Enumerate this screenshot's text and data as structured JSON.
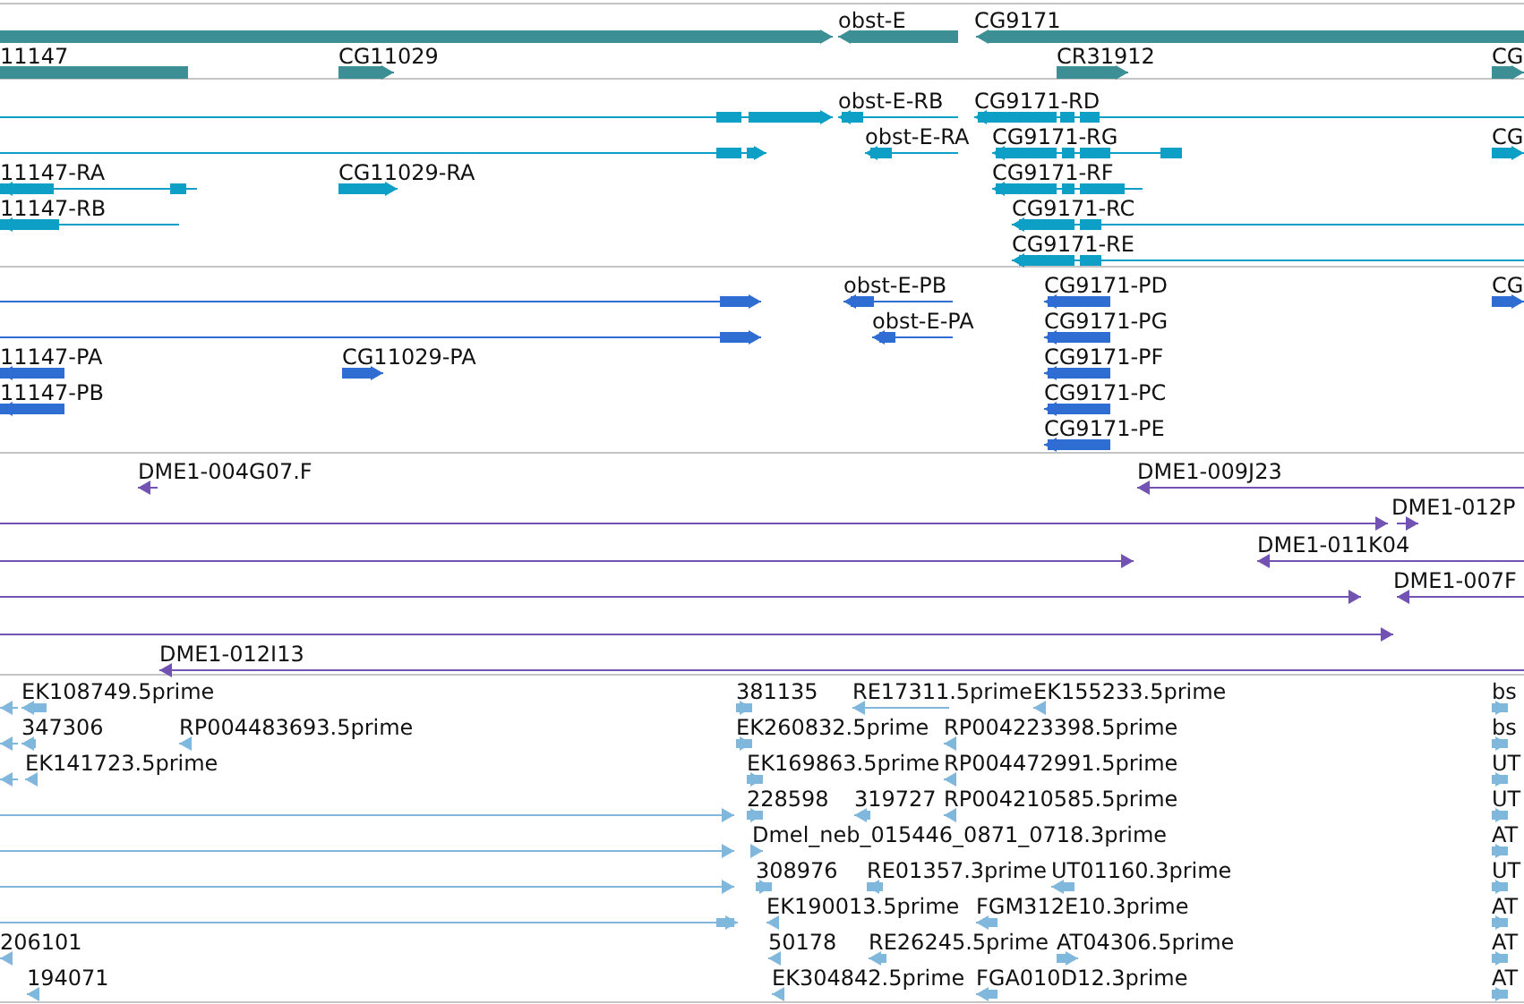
{
  "tracks": [
    {
      "kind": "gene",
      "color": "#3d8f96",
      "features": [
        {
          "reverse": false
        },
        {
          "label": "obst-E",
          "reverse": true
        },
        {
          "label": "CG9171",
          "reverse": true
        },
        {
          "label": "11147"
        },
        {
          "label": "CG11029",
          "reverse": false
        },
        {
          "label": "CR31912",
          "reverse": false
        },
        {
          "label": "CG",
          "reverse": false
        }
      ]
    },
    {
      "kind": "transcript",
      "color": "#0e9fc6",
      "features": [
        {
          "reverse": false
        },
        {
          "label": "obst-E-RB",
          "reverse": true
        },
        {
          "label": "CG9171-RD",
          "reverse": true
        },
        {
          "reverse": false
        },
        {
          "label": "obst-E-RA",
          "reverse": true
        },
        {
          "label": "CG9171-RG",
          "reverse": true
        },
        {
          "label": "CG",
          "reverse": false
        },
        {
          "label": "11147-RA",
          "reverse": true
        },
        {
          "label": "CG11029-RA",
          "reverse": false
        },
        {
          "label": "CG9171-RF",
          "reverse": true
        },
        {
          "label": "11147-RB",
          "reverse": true
        },
        {
          "label": "CG9171-RC",
          "reverse": true
        },
        {
          "label": "CG9171-RE",
          "reverse": true
        }
      ]
    },
    {
      "kind": "protein",
      "color": "#2f6dd3",
      "features": [
        {
          "reverse": false
        },
        {
          "label": "obst-E-PB",
          "reverse": true
        },
        {
          "label": "CG9171-PD",
          "reverse": true
        },
        {
          "label": "CG",
          "reverse": false
        },
        {
          "reverse": false
        },
        {
          "label": "obst-E-PA",
          "reverse": true
        },
        {
          "label": "CG9171-PG",
          "reverse": true
        },
        {
          "label": "11147-PA",
          "reverse": true
        },
        {
          "label": "CG11029-PA",
          "reverse": false
        },
        {
          "label": "CG9171-PF",
          "reverse": true
        },
        {
          "label": "11147-PB",
          "reverse": true
        },
        {
          "label": "CG9171-PC",
          "reverse": true
        },
        {
          "label": "CG9171-PE",
          "reverse": true
        }
      ]
    },
    {
      "kind": "clone",
      "color": "#7252b2",
      "features": [
        {
          "label": "DME1-004G07.F",
          "reverse": true
        },
        {
          "label": "DME1-009J23",
          "reverse": true
        },
        {
          "reverse": false
        },
        {
          "label": "DME1-012P",
          "reverse": false
        },
        {
          "reverse": false
        },
        {
          "label": "DME1-011K04",
          "reverse": true
        },
        {
          "reverse": false
        },
        {
          "label": "DME1-007F",
          "reverse": true
        },
        {
          "reverse": false
        },
        {
          "label": "DME1-012I13",
          "reverse": true
        }
      ]
    },
    {
      "kind": "est",
      "color": "#80b7dd",
      "features": [
        {
          "reverse": true
        },
        {
          "label": "EK108749.5prime",
          "reverse": true
        },
        {
          "label": "381135",
          "reverse": false
        },
        {
          "label": "RE17311.5prime",
          "reverse": true
        },
        {
          "label": "EK155233.5prime",
          "reverse": true
        },
        {
          "label": "bs",
          "reverse": false
        },
        {
          "reverse": true
        },
        {
          "label": "347306",
          "reverse": true
        },
        {
          "label": "RP004483693.5prime",
          "reverse": true
        },
        {
          "label": "EK260832.5prime",
          "reverse": false
        },
        {
          "label": "RP004223398.5prime",
          "reverse": true
        },
        {
          "label": "bs",
          "reverse": false
        },
        {
          "reverse": true
        },
        {
          "label": "EK141723.5prime",
          "reverse": true
        },
        {
          "label": "EK169863.5prime",
          "reverse": false
        },
        {
          "label": "RP004472991.5prime",
          "reverse": true
        },
        {
          "label": "UT",
          "reverse": false
        },
        {
          "reverse": false
        },
        {
          "label": "228598",
          "reverse": false
        },
        {
          "label": "319727",
          "reverse": true
        },
        {
          "label": "RP004210585.5prime",
          "reverse": true
        },
        {
          "label": "UT",
          "reverse": false
        },
        {
          "reverse": false
        },
        {
          "label": "Dmel_neb_015446_0871_0718.3prime",
          "reverse": false
        },
        {
          "label": "AT",
          "reverse": false
        },
        {
          "reverse": false
        },
        {
          "label": "308976",
          "reverse": false
        },
        {
          "label": "RE01357.3prime",
          "reverse": true
        },
        {
          "label": "UT01160.3prime",
          "reverse": true
        },
        {
          "label": "UT",
          "reverse": false
        },
        {
          "reverse": false
        },
        {
          "label": "EK190013.5prime",
          "reverse": true
        },
        {
          "label": "FGM312E10.3prime",
          "reverse": true
        },
        {
          "label": "AT",
          "reverse": false
        },
        {
          "label": "206101",
          "reverse": true
        },
        {
          "label": "50178",
          "reverse": true
        },
        {
          "label": "RE26245.5prime",
          "reverse": true
        },
        {
          "label": "AT04306.5prime",
          "reverse": false
        },
        {
          "label": "AT",
          "reverse": false
        },
        {
          "label": "194071",
          "reverse": true
        },
        {
          "label": "EK304842.5prime",
          "reverse": true
        },
        {
          "label": "FGA010D12.3prime",
          "reverse": true
        },
        {
          "label": "AT",
          "reverse": false
        }
      ]
    }
  ]
}
